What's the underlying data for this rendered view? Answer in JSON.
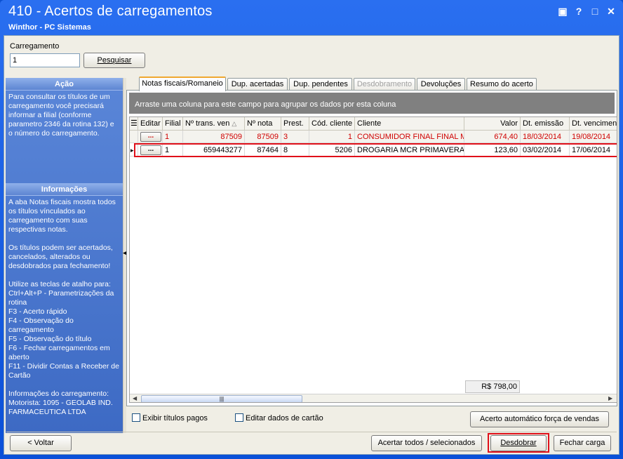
{
  "window": {
    "title": "410 - Acertos de carregamentos",
    "subtitle": "Winthor - PC Sistemas",
    "controls": {
      "restore": "▣",
      "help": "?",
      "minimize": "—",
      "maximize": "□",
      "close": "✕"
    }
  },
  "filter": {
    "label": "Carregamento",
    "value": "1",
    "search_button": "Pesquisar"
  },
  "left_panel": {
    "acao_title": "Ação",
    "acao_text": "Para consultar os títulos de um carregamento você precisará informar a filial (conforme parametro 2346 da rotina 132) e o número do carregamento.",
    "info_title": "Informações",
    "info_text": "A aba Notas fiscais mostra todos os títulos vínculados ao carregamento com suas respectivas notas.\n\nOs títulos podem ser acertados, cancelados, alterados ou desdobrados para fechamento!\n\nUtilize as teclas de atalho para:\nCtrl+Alt+P - Parametrizações da rotina\nF3 - Acerto rápido\nF4 - Observação do carregamento\nF5 - Observação do título\nF6 - Fechar carregamentos em aberto\nF11 - Dividir Contas a Receber de Cartão\n\nInformações do carregamento:\nMotorista: 1095 - GEOLAB IND. FARMACEUTICA LTDA"
  },
  "tabs": [
    {
      "label": "Notas fiscais/Romaneio",
      "state": "active"
    },
    {
      "label": "Dup. acertadas",
      "state": "normal"
    },
    {
      "label": "Dup. pendentes",
      "state": "normal"
    },
    {
      "label": "Desdobramento",
      "state": "disabled"
    },
    {
      "label": "Devoluções",
      "state": "normal"
    },
    {
      "label": "Resumo do acerto",
      "state": "normal"
    }
  ],
  "grid": {
    "group_hint": "Arraste uma coluna para este campo para agrupar os dados por esta coluna",
    "headers": {
      "editar": "Editar",
      "filial": "Filial",
      "trans": "Nº trans. ven",
      "nota": "Nº nota",
      "prest": "Prest.",
      "cod_cliente": "Cód. cliente",
      "cliente": "Cliente",
      "valor": "Valor",
      "dt_emissao": "Dt. emissão",
      "dt_venc": "Dt. venciment"
    },
    "edit_button": "...",
    "rows": [
      {
        "filial": "1",
        "trans": "87509",
        "nota": "87509",
        "prest": "3",
        "cod_cliente": "1",
        "cliente": "CONSUMIDOR FINAL FINAL MES",
        "valor": "674,40",
        "dt_emissao": "18/03/2014",
        "dt_venc": "19/08/2014"
      },
      {
        "filial": "1",
        "trans": "659443277",
        "nota": "87464",
        "prest": "8",
        "cod_cliente": "5206",
        "cliente": "DROGARIA MCR PRIMAVERA LTDA",
        "valor": "123,60",
        "dt_emissao": "03/02/2014",
        "dt_venc": "17/06/2014"
      }
    ],
    "total_valor": "R$ 798,00",
    "colors": {
      "pending_row_text": "#d00000",
      "highlight_outline": "#e0101a"
    }
  },
  "options": {
    "exibir_pagos": "Exibir títulos pagos",
    "editar_cartao": "Editar dados de cartão",
    "acerto_auto_button": "Acerto automático força de vendas"
  },
  "footer": {
    "voltar": "< Voltar",
    "acertar": "Acertar todos / selecionados",
    "desdobrar": "Desdobrar",
    "fechar": "Fechar carga"
  }
}
